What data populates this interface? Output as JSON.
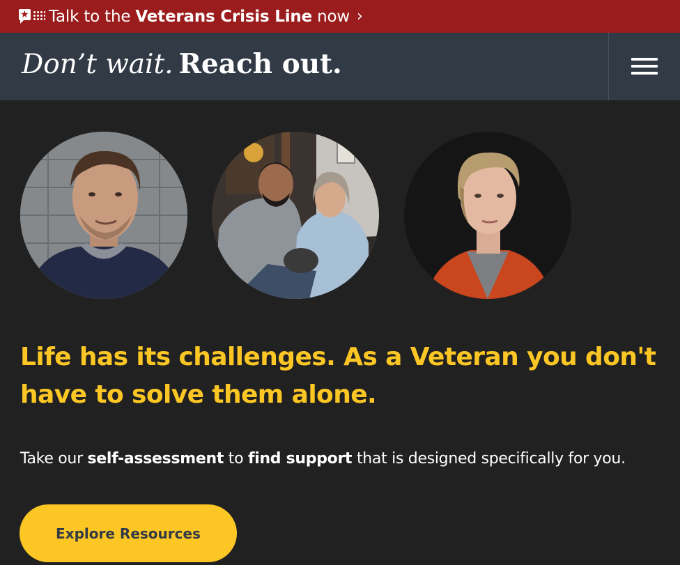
{
  "crisis_banner": {
    "prefix": "Talk to the ",
    "emphasis": "Veterans Crisis Line",
    "suffix": " now",
    "chevron": "›",
    "icon": "crisis-line-logo-icon",
    "background": "#9b1c1c"
  },
  "header": {
    "tagline_italic": "Don’t wait.",
    "tagline_bold": "Reach out.",
    "menu_icon": "hamburger-menu-icon",
    "background": "#323a45"
  },
  "hero": {
    "photos": [
      {
        "name": "veteran-man-portrait"
      },
      {
        "name": "veteran-couple-portrait"
      },
      {
        "name": "veteran-woman-portrait"
      }
    ],
    "headline": "Life has its challenges. As a Veteran you don't have to solve them alone.",
    "intro": {
      "part1": "Take our ",
      "bold1": "self-assessment",
      "part2": " to ",
      "bold2": "find support",
      "part3": " that is designed specifically for you."
    },
    "cta_label": "Explore Resources"
  },
  "colors": {
    "page_background": "#212121",
    "accent_yellow": "#fcc724",
    "text_white": "#ffffff"
  }
}
